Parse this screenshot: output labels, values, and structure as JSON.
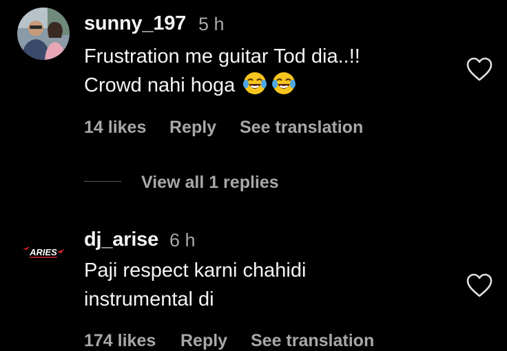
{
  "comments": [
    {
      "username": "sunny_197",
      "time": "5 h",
      "text_line1": "Frustration me guitar Tod dia..!!",
      "text_line2": "Crowd nahi hoga",
      "emoji": [
        "face-with-tears-of-joy",
        "face-with-tears-of-joy"
      ],
      "likes": "14 likes",
      "reply": "Reply",
      "translation": "See translation",
      "view_replies": "View all 1 replies"
    },
    {
      "username": "dj_arise",
      "time": "6 h",
      "text_line1": "Paji respect karni chahidi",
      "text_line2": "instrumental di",
      "avatar_text": "ARIES",
      "likes": "174 likes",
      "reply": "Reply",
      "translation": "See translation"
    }
  ],
  "colors": {
    "background": "#000000",
    "primary_text": "#f5f5f5",
    "secondary_text": "#a8a8a8",
    "avatar_logo_red": "#d0202a"
  }
}
